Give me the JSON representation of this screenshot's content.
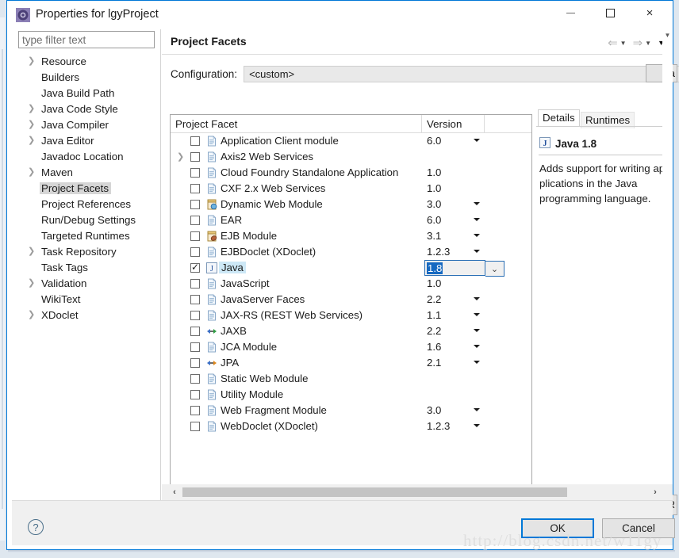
{
  "window": {
    "title": "Properties for lgyProject",
    "icon": "properties-gear-icon",
    "minimize_label": "",
    "maximize_label": "",
    "close_label": "×"
  },
  "sidebar": {
    "filter": {
      "value": "",
      "placeholder": "type filter text"
    },
    "items": [
      {
        "label": "Resource",
        "expandable": true,
        "selected": false
      },
      {
        "label": "Builders",
        "expandable": false,
        "selected": false
      },
      {
        "label": "Java Build Path",
        "expandable": false,
        "selected": false
      },
      {
        "label": "Java Code Style",
        "expandable": true,
        "selected": false
      },
      {
        "label": "Java Compiler",
        "expandable": true,
        "selected": false
      },
      {
        "label": "Java Editor",
        "expandable": true,
        "selected": false
      },
      {
        "label": "Javadoc Location",
        "expandable": false,
        "selected": false
      },
      {
        "label": "Maven",
        "expandable": true,
        "selected": false
      },
      {
        "label": "Project Facets",
        "expandable": false,
        "selected": true
      },
      {
        "label": "Project References",
        "expandable": false,
        "selected": false
      },
      {
        "label": "Run/Debug Settings",
        "expandable": false,
        "selected": false
      },
      {
        "label": "Targeted Runtimes",
        "expandable": false,
        "selected": false
      },
      {
        "label": "Task Repository",
        "expandable": true,
        "selected": false
      },
      {
        "label": "Task Tags",
        "expandable": false,
        "selected": false
      },
      {
        "label": "Validation",
        "expandable": true,
        "selected": false
      },
      {
        "label": "WikiText",
        "expandable": false,
        "selected": false
      },
      {
        "label": "XDoclet",
        "expandable": true,
        "selected": false
      }
    ]
  },
  "main": {
    "page_title": "Project Facets",
    "nav": {
      "back": "⇐",
      "forward": "⇒",
      "caret": "▼",
      "menu_caret": "▼"
    },
    "configuration": {
      "label": "Configuration:",
      "value": "<custom>",
      "caret": "⌄",
      "save_as_label": "Sa"
    },
    "table": {
      "columns": [
        "Project Facet",
        "Version"
      ],
      "rows": [
        {
          "facet": "Application Client module",
          "version": "6.0",
          "checked": false,
          "expandable": false,
          "has_caret": true,
          "icon": "document-icon",
          "selected": false,
          "editing": false
        },
        {
          "facet": "Axis2 Web Services",
          "version": "",
          "checked": false,
          "expandable": true,
          "has_caret": false,
          "icon": "document-icon",
          "selected": false,
          "editing": false
        },
        {
          "facet": "Cloud Foundry Standalone Application",
          "version": "1.0",
          "checked": false,
          "expandable": false,
          "has_caret": false,
          "icon": "document-icon",
          "selected": false,
          "editing": false
        },
        {
          "facet": "CXF 2.x Web Services",
          "version": "1.0",
          "checked": false,
          "expandable": false,
          "has_caret": false,
          "icon": "document-icon",
          "selected": false,
          "editing": false
        },
        {
          "facet": "Dynamic Web Module",
          "version": "3.0",
          "checked": false,
          "expandable": false,
          "has_caret": true,
          "icon": "web-module-icon",
          "selected": false,
          "editing": false
        },
        {
          "facet": "EAR",
          "version": "6.0",
          "checked": false,
          "expandable": false,
          "has_caret": true,
          "icon": "document-icon",
          "selected": false,
          "editing": false
        },
        {
          "facet": "EJB Module",
          "version": "3.1",
          "checked": false,
          "expandable": false,
          "has_caret": true,
          "icon": "ejb-module-icon",
          "selected": false,
          "editing": false
        },
        {
          "facet": "EJBDoclet (XDoclet)",
          "version": "1.2.3",
          "checked": false,
          "expandable": false,
          "has_caret": true,
          "icon": "document-icon",
          "selected": false,
          "editing": false
        },
        {
          "facet": "Java",
          "version": "1.8",
          "checked": true,
          "expandable": false,
          "has_caret": false,
          "icon": "java-icon",
          "selected": true,
          "editing": true
        },
        {
          "facet": "JavaScript",
          "version": "1.0",
          "checked": false,
          "expandable": false,
          "has_caret": false,
          "icon": "document-icon",
          "selected": false,
          "editing": false
        },
        {
          "facet": "JavaServer Faces",
          "version": "2.2",
          "checked": false,
          "expandable": false,
          "has_caret": true,
          "icon": "document-icon",
          "selected": false,
          "editing": false
        },
        {
          "facet": "JAX-RS (REST Web Services)",
          "version": "1.1",
          "checked": false,
          "expandable": false,
          "has_caret": true,
          "icon": "document-icon",
          "selected": false,
          "editing": false
        },
        {
          "facet": "JAXB",
          "version": "2.2",
          "checked": false,
          "expandable": false,
          "has_caret": true,
          "icon": "jaxb-icon",
          "selected": false,
          "editing": false
        },
        {
          "facet": "JCA Module",
          "version": "1.6",
          "checked": false,
          "expandable": false,
          "has_caret": true,
          "icon": "document-icon",
          "selected": false,
          "editing": false
        },
        {
          "facet": "JPA",
          "version": "2.1",
          "checked": false,
          "expandable": false,
          "has_caret": true,
          "icon": "jpa-icon",
          "selected": false,
          "editing": false
        },
        {
          "facet": "Static Web Module",
          "version": "",
          "checked": false,
          "expandable": false,
          "has_caret": false,
          "icon": "document-icon",
          "selected": false,
          "editing": false
        },
        {
          "facet": "Utility Module",
          "version": "",
          "checked": false,
          "expandable": false,
          "has_caret": false,
          "icon": "document-icon",
          "selected": false,
          "editing": false
        },
        {
          "facet": "Web Fragment Module",
          "version": "3.0",
          "checked": false,
          "expandable": false,
          "has_caret": true,
          "icon": "document-icon",
          "selected": false,
          "editing": false
        },
        {
          "facet": "WebDoclet (XDoclet)",
          "version": "1.2.3",
          "checked": false,
          "expandable": false,
          "has_caret": true,
          "icon": "document-icon",
          "selected": false,
          "editing": false
        }
      ]
    },
    "runtimes_button_label": "R",
    "hscroll": {
      "left_arrow": "‹",
      "right_arrow": "›"
    },
    "vscroll": {
      "up_arrow": "▼"
    }
  },
  "details": {
    "tabs": [
      {
        "label": "Details",
        "active": true
      },
      {
        "label": "Runtimes",
        "active": false
      }
    ],
    "facet_title": "Java 1.8",
    "facet_icon": "java-icon",
    "description": "Adds support for writing ap plications in the Java programming language."
  },
  "footer": {
    "help_icon": "?",
    "ok_label": "OK",
    "cancel_label": "Cancel"
  },
  "watermark": {
    "text": "http://blog.csdn.net/w11gy"
  },
  "colors": {
    "accent": "#0078d7",
    "selection_blue": "#1669c1",
    "row_selection": "#cde8f6",
    "sidebar_selection": "#d6d6d6",
    "button_face": "#e4e4e4",
    "panel_gray": "#f0f0f0"
  }
}
